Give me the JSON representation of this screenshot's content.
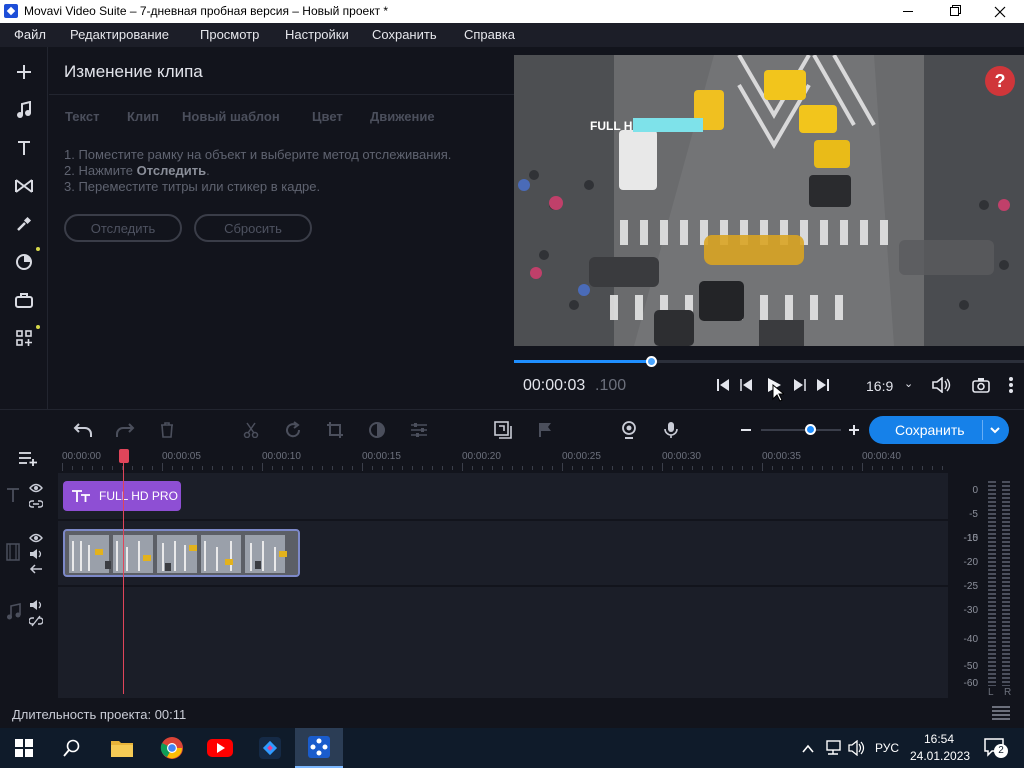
{
  "window": {
    "title": "Movavi Video Suite – 7-дневная пробная версия – Новый проект *"
  },
  "menu": [
    "Файл",
    "Редактирование",
    "Просмотр",
    "Настройки",
    "Сохранить",
    "Справка"
  ],
  "panel": {
    "title": "Изменение клипа",
    "tabs": [
      "Текст",
      "Клип",
      "Новый шаблон",
      "Цвет",
      "Движение"
    ],
    "step1": "1. Поместите рамку на объект и выберите метод отслеживания.",
    "step2_prefix": "2. Нажмите ",
    "step2_bold": "Отследить",
    "step2_suffix": ".",
    "step3": "3. Переместите титры или стикер в кадре.",
    "track_button": "Отследить",
    "reset_button": "Сбросить"
  },
  "preview": {
    "overlay_text": "FULL HD",
    "help": "?"
  },
  "player": {
    "time_main": "00:00:03",
    "time_ms": ".100",
    "aspect": "16:9",
    "progress": 0.27
  },
  "toolbar": {
    "save_label": "Сохранить",
    "zoom": 0.62
  },
  "ruler": [
    "00:00:00",
    "00:00:05",
    "00:00:10",
    "00:00:15",
    "00:00:20",
    "00:00:25",
    "00:00:30",
    "00:00:35",
    "00:00:40"
  ],
  "timeline": {
    "title_clip": "FULL HD PRO"
  },
  "meter": {
    "scale": [
      "0",
      "-5",
      "-10",
      "-15",
      "-20",
      "-25",
      "-30",
      "-40",
      "-50",
      "-60"
    ],
    "left": "L",
    "right": "R"
  },
  "status": {
    "duration": "Длительность проекта: 00:11"
  },
  "taskbar": {
    "lang": "РУС",
    "time": "16:54",
    "date": "24.01.2023",
    "notifications": "2"
  },
  "colors": {
    "accent": "#1681e9",
    "title_clip": "#8e4fd4",
    "playhead": "#e0455a"
  }
}
